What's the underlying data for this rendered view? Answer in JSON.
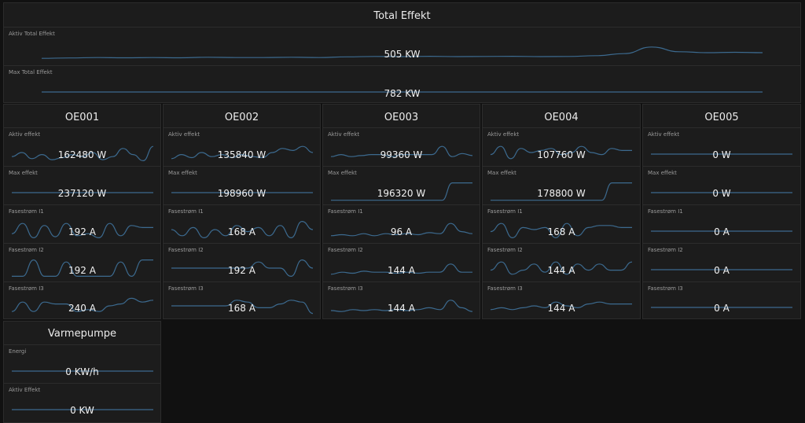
{
  "colors": {
    "background": "#111111",
    "panel": "#1c1c1c",
    "border": "#2c2c2c",
    "sparkline": "#3c6a8f"
  },
  "total": {
    "title": "Total Effekt",
    "cells": [
      {
        "label": "Aktiv Total Effekt",
        "value": "505 KW",
        "trend": [
          0.8,
          0.78,
          0.76,
          0.77,
          0.76,
          0.77,
          0.74,
          0.76,
          0.76,
          0.74,
          0.76,
          0.72,
          0.7,
          0.71,
          0.69,
          0.71,
          0.7,
          0.69,
          0.71,
          0.7,
          0.66,
          0.55,
          0.2,
          0.45,
          0.5,
          0.48,
          0.5
        ]
      },
      {
        "label": "Max Total Effekt",
        "value": "782 KW",
        "trend": [
          0.5,
          0.5
        ]
      }
    ]
  },
  "units": [
    {
      "title": "OE001",
      "cells": [
        {
          "label": "Aktiv effekt",
          "value": "162480 W",
          "trend": [
            0.7,
            0.5,
            0.8,
            0.6,
            0.85,
            0.75,
            0.6,
            0.7,
            0.5,
            0.85,
            0.7,
            0.3,
            0.6,
            0.9,
            0.2
          ]
        },
        {
          "label": "Max effekt",
          "value": "237120 W",
          "trend": [
            0.5,
            0.5
          ]
        },
        {
          "label": "Fasestrøm I1",
          "value": "192 A",
          "trend": [
            0.7,
            0.2,
            0.9,
            0.3,
            0.85,
            0.2,
            0.8,
            0.7,
            0.9,
            0.2,
            0.8,
            0.3,
            0.4,
            0.4
          ]
        },
        {
          "label": "Fasestrøm I2",
          "value": "192 A",
          "trend": [
            0.9,
            0.9,
            0.1,
            0.9,
            0.9,
            0.2,
            0.9,
            0.9,
            0.9,
            0.9,
            0.2,
            0.9,
            0.1,
            0.1
          ]
        },
        {
          "label": "Fasestrøm I3",
          "value": "240 A",
          "trend": [
            0.8,
            0.3,
            0.8,
            0.3,
            0.4,
            0.4,
            0.8,
            0.7,
            0.8,
            0.5,
            0.4,
            0.1,
            0.3,
            0.2
          ]
        }
      ]
    },
    {
      "title": "OE002",
      "cells": [
        {
          "label": "Aktiv effekt",
          "value": "135840 W",
          "trend": [
            0.8,
            0.6,
            0.75,
            0.5,
            0.7,
            0.6,
            0.75,
            0.6,
            0.7,
            0.75,
            0.5,
            0.3,
            0.4,
            0.2,
            0.5
          ]
        },
        {
          "label": "Max effekt",
          "value": "198960 W",
          "trend": [
            0.5,
            0.5
          ]
        },
        {
          "label": "Fasestrøm I1",
          "value": "168 A",
          "trend": [
            0.5,
            0.8,
            0.4,
            0.9,
            0.5,
            0.8,
            0.3,
            0.6,
            0.4,
            0.8,
            0.3,
            0.9,
            0.1,
            0.5
          ]
        },
        {
          "label": "Fasestrøm I2",
          "value": "192 A",
          "trend": [
            0.5,
            0.5,
            0.5,
            0.5,
            0.5,
            0.5,
            0.5,
            0.5,
            0.2,
            0.5,
            0.5,
            0.9,
            0.1,
            0.5
          ]
        },
        {
          "label": "Fasestrøm I3",
          "value": "168 A",
          "trend": [
            0.5,
            0.5,
            0.5,
            0.5,
            0.5,
            0.5,
            0.2,
            0.3,
            0.6,
            0.6,
            0.4,
            0.2,
            0.3,
            0.9
          ]
        }
      ]
    },
    {
      "title": "OE003",
      "cells": [
        {
          "label": "Aktiv effekt",
          "value": "99360 W",
          "trend": [
            0.7,
            0.6,
            0.7,
            0.65,
            0.6,
            0.6,
            0.7,
            0.6,
            0.6,
            0.6,
            0.6,
            0.2,
            0.7,
            0.55,
            0.65
          ]
        },
        {
          "label": "Max effekt",
          "value": "196320 W",
          "trend": [
            0.95,
            0.95,
            0.95,
            0.95,
            0.95,
            0.95,
            0.95,
            0.95,
            0.95,
            0.95,
            0.95,
            0.95,
            0.1,
            0.1,
            0.1
          ]
        },
        {
          "label": "Fasestrøm I1",
          "value": "96 A",
          "trend": [
            0.8,
            0.75,
            0.8,
            0.7,
            0.8,
            0.7,
            0.75,
            0.7,
            0.75,
            0.65,
            0.7,
            0.2,
            0.6,
            0.7
          ]
        },
        {
          "label": "Fasestrøm I2",
          "value": "144 A",
          "trend": [
            0.8,
            0.7,
            0.75,
            0.65,
            0.7,
            0.7,
            0.75,
            0.7,
            0.75,
            0.7,
            0.7,
            0.3,
            0.7,
            0.7
          ]
        },
        {
          "label": "Fasestrøm I3",
          "value": "144 A",
          "trend": [
            0.75,
            0.8,
            0.7,
            0.75,
            0.7,
            0.75,
            0.7,
            0.75,
            0.7,
            0.6,
            0.7,
            0.2,
            0.6,
            0.8
          ]
        }
      ]
    },
    {
      "title": "OE004",
      "cells": [
        {
          "label": "Aktiv effekt",
          "value": "107760 W",
          "trend": [
            0.6,
            0.2,
            0.8,
            0.3,
            0.5,
            0.4,
            0.3,
            0.6,
            0.5,
            0.2,
            0.5,
            0.6,
            0.3,
            0.4,
            0.4
          ]
        },
        {
          "label": "Max effekt",
          "value": "178800 W",
          "trend": [
            0.95,
            0.95,
            0.95,
            0.95,
            0.95,
            0.95,
            0.95,
            0.95,
            0.95,
            0.95,
            0.95,
            0.95,
            0.1,
            0.1,
            0.1
          ]
        },
        {
          "label": "Fasestrøm I1",
          "value": "168 A",
          "trend": [
            0.6,
            0.2,
            0.9,
            0.4,
            0.5,
            0.4,
            0.9,
            0.2,
            0.8,
            0.4,
            0.3,
            0.3,
            0.4,
            0.4
          ]
        },
        {
          "label": "Fasestrøm I2",
          "value": "144 A",
          "trend": [
            0.6,
            0.2,
            0.8,
            0.6,
            0.3,
            0.7,
            0.2,
            0.8,
            0.3,
            0.6,
            0.3,
            0.6,
            0.6,
            0.2
          ]
        },
        {
          "label": "Fasestrøm I3",
          "value": "144 A",
          "trend": [
            0.7,
            0.6,
            0.7,
            0.6,
            0.5,
            0.6,
            0.3,
            0.5,
            0.6,
            0.4,
            0.3,
            0.4,
            0.4,
            0.4
          ]
        }
      ]
    },
    {
      "title": "OE005",
      "cells": [
        {
          "label": "Aktiv effekt",
          "value": "0 W",
          "trend": [
            0.5,
            0.5
          ]
        },
        {
          "label": "Max effekt",
          "value": "0 W",
          "trend": [
            0.5,
            0.5
          ]
        },
        {
          "label": "Fasestrøm I1",
          "value": "0 A",
          "trend": [
            0.5,
            0.5
          ]
        },
        {
          "label": "Fasestrøm I2",
          "value": "0 A",
          "trend": [
            0.5,
            0.5
          ]
        },
        {
          "label": "Fasestrøm I3",
          "value": "0 A",
          "trend": [
            0.5,
            0.5
          ]
        }
      ]
    }
  ],
  "heatpump": {
    "title": "Varmepumpe",
    "cells": [
      {
        "label": "Energi",
        "value": "0 KW/h",
        "trend": [
          0.5,
          0.5
        ]
      },
      {
        "label": "Aktiv Effekt",
        "value": "0 KW",
        "trend": [
          0.5,
          0.5
        ]
      }
    ]
  }
}
